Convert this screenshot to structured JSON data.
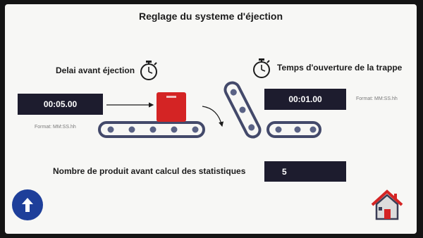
{
  "screen": {
    "title": "Reglage du systeme d'éjection"
  },
  "delay": {
    "label": "Delai avant éjection",
    "value": "00:05.00",
    "format": "Format: MM:SS.hh",
    "icon": "stopwatch-icon"
  },
  "opening": {
    "label": "Temps  d'ouverture de la trappe",
    "value": "00:01.00",
    "format": "Format: MM:SS.hh",
    "icon": "stopwatch-icon"
  },
  "products": {
    "label": "Nombre de produit avant calcul des statistiques",
    "value": "5"
  },
  "nav": {
    "back_icon": "arrow-up-icon",
    "home_icon": "home-icon"
  },
  "colors": {
    "field_bg": "#1d1c2e",
    "conveyor": "#43496a",
    "product": "#d42424",
    "nav_button": "#1e3f9a",
    "home_roof": "#d42424"
  }
}
